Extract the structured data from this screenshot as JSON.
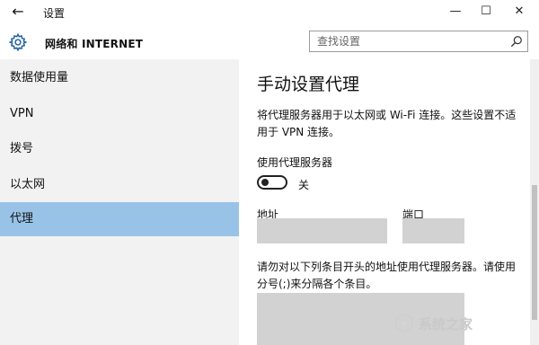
{
  "window": {
    "back_glyph": "←",
    "title": "设置",
    "minimize_glyph": "—",
    "maximize_glyph": "☐",
    "close_glyph": "✕"
  },
  "header": {
    "section_title": "网络和 INTERNET",
    "search_placeholder": "查找设置",
    "search_value": ""
  },
  "sidebar": {
    "items": [
      {
        "label": "数据使用量",
        "active": false
      },
      {
        "label": "VPN",
        "active": false
      },
      {
        "label": "拨号",
        "active": false
      },
      {
        "label": "以太网",
        "active": false
      },
      {
        "label": "代理",
        "active": true
      }
    ]
  },
  "main": {
    "heading": "手动设置代理",
    "description": "将代理服务器用于以太网或 Wi-Fi 连接。这些设置不适用于 VPN 连接。",
    "use_proxy_label": "使用代理服务器",
    "toggle_state": "关",
    "address_label": "地址",
    "address_value": "",
    "port_label": "端口",
    "port_value": "",
    "exceptions_text": "请勿对以下列条目开头的地址使用代理服务器。请使用分号(;)来分隔各个条目。",
    "exceptions_value": ""
  },
  "watermark": {
    "text": "系统之家"
  },
  "colors": {
    "active_item": "#99c3e6",
    "sidebar_bg": "#f2f2f2",
    "field_bg": "#d2d2d2"
  }
}
